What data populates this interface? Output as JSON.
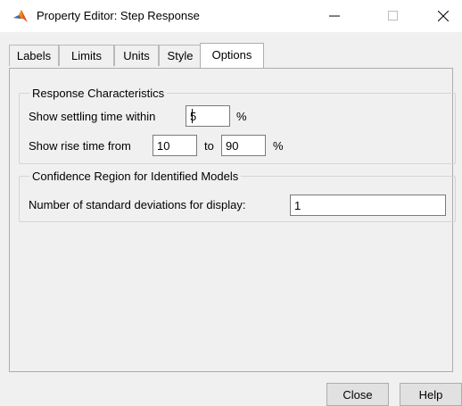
{
  "window": {
    "title": "Property Editor: Step Response",
    "icon": "matlab-logo-icon"
  },
  "tabs": [
    {
      "label": "Labels",
      "selected": false
    },
    {
      "label": "Limits",
      "selected": false
    },
    {
      "label": "Units",
      "selected": false
    },
    {
      "label": "Style",
      "selected": false
    },
    {
      "label": "Options",
      "selected": true
    }
  ],
  "response_characteristics": {
    "title": "Response Characteristics",
    "settling_label": "Show settling time within",
    "settling_value": "5",
    "settling_unit": "%",
    "rise_label": "Show rise time from",
    "rise_from": "10",
    "rise_to_label": "to",
    "rise_to": "90",
    "rise_unit": "%"
  },
  "confidence_region": {
    "title": "Confidence Region for Identified Models",
    "std_label": "Number of standard deviations for display:",
    "std_value": "1"
  },
  "buttons": {
    "close": "Close",
    "help": "Help"
  }
}
